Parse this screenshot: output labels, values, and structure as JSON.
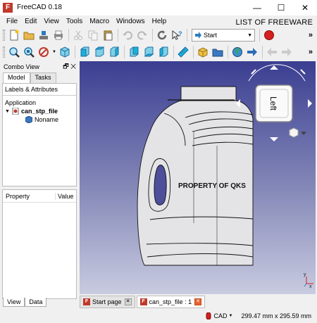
{
  "window": {
    "title": "FreeCAD 0.18",
    "app_icon": "freecad-icon",
    "minimize": "—",
    "maximize": "☐",
    "close": "✕",
    "watermark": "LIST OF FREEWARE"
  },
  "menu": [
    "File",
    "Edit",
    "View",
    "Tools",
    "Macro",
    "Windows",
    "Help"
  ],
  "toolbar": {
    "workbench_selected": "Start",
    "overflow": "»"
  },
  "combo_view": {
    "title": "Combo View",
    "header_controls": "🗗 ✕",
    "tabs": [
      "Model",
      "Tasks"
    ],
    "labels_tab": "Labels & Attributes",
    "tree": {
      "root": "Application",
      "document": "can_stp_file",
      "child": "Noname"
    },
    "property_headers": [
      "Property",
      "Value"
    ],
    "bottom_tabs": [
      "View",
      "Data"
    ]
  },
  "viewport": {
    "model_label": "PROPERTY OF QKS",
    "navcube_face": "Left",
    "axis_x": "x",
    "axis_y": "y",
    "axis_z": "z"
  },
  "doc_tabs": [
    {
      "label": "Start page",
      "active": false
    },
    {
      "label": "can_stp_file : 1",
      "active": true
    }
  ],
  "status": {
    "nav_style": "CAD",
    "dimensions": "299.47 mm x 295.59 mm"
  },
  "colors": {
    "viewport_top": "#3b3e91",
    "viewport_bottom": "#c9cbe0",
    "record_red": "#d61f1f",
    "accent_blue": "#2b7bbd"
  }
}
